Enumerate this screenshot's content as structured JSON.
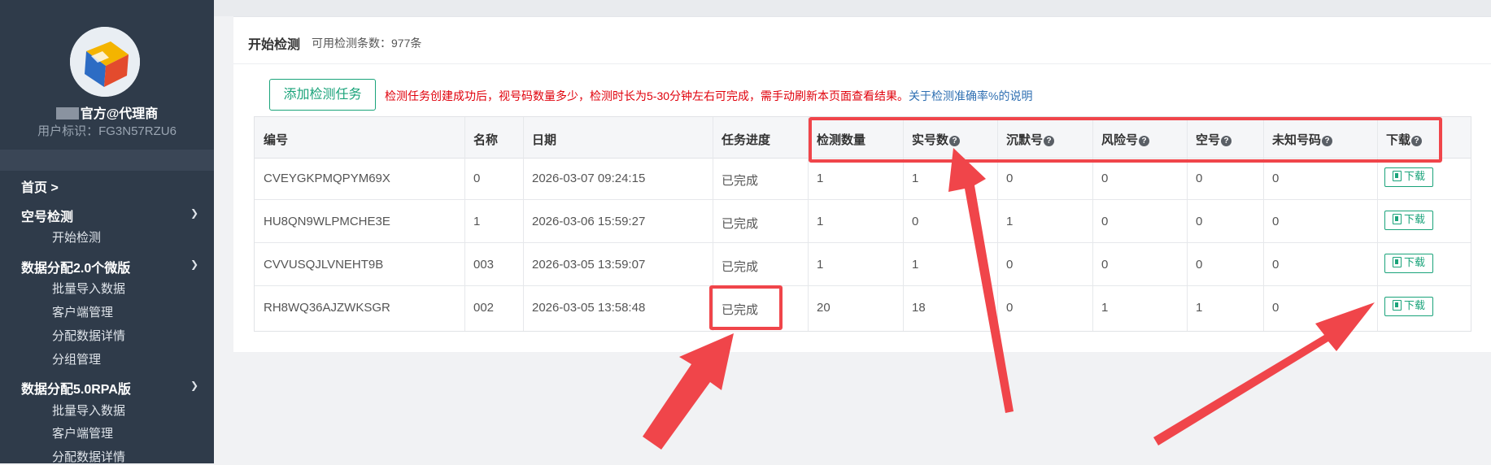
{
  "sidebar": {
    "user_name": "官方@代理商",
    "user_id": "用户标识：FG3N57RZU6",
    "home": "首页 >",
    "groups": [
      {
        "label": "空号检测",
        "items": [
          "开始检测"
        ]
      },
      {
        "label": "数据分配2.0个微版",
        "items": [
          "批量导入数据",
          "客户端管理",
          "分配数据详情",
          "分组管理"
        ]
      },
      {
        "label": "数据分配5.0RPA版",
        "items": [
          "批量导入数据",
          "客户端管理",
          "分配数据详情"
        ]
      }
    ]
  },
  "panel": {
    "title": "开始检测",
    "available": "可用检测条数：977条",
    "add_button": "添加检测任务",
    "notice": "检测任务创建成功后，视号码数量多少，检测时长为5-30分钟左右可完成，需手动刷新本页面查看结果。",
    "notice_link": "关于检测准确率%的说明"
  },
  "table": {
    "columns": [
      "编号",
      "名称",
      "日期",
      "任务进度",
      "检测数量",
      "实号数",
      "沉默号",
      "风险号",
      "空号",
      "未知号码",
      "下载"
    ],
    "help_icon": "?",
    "download_label": "下载",
    "rows": [
      [
        "CVEYGKPMQPYM69X",
        "0",
        "2026-03-07 09:24:15",
        "已完成",
        "1",
        "1",
        "0",
        "0",
        "0",
        "0"
      ],
      [
        "HU8QN9WLPMCHE3E",
        "1",
        "2026-03-06 15:59:27",
        "已完成",
        "1",
        "0",
        "1",
        "0",
        "0",
        "0"
      ],
      [
        "CVVUSQJLVNEHT9B",
        "003",
        "2026-03-05 13:59:07",
        "已完成",
        "1",
        "1",
        "0",
        "0",
        "0",
        "0"
      ],
      [
        "RH8WQ36AJZWKSGR",
        "002",
        "2026-03-05 13:58:48",
        "已完成",
        "20",
        "18",
        "0",
        "1",
        "1",
        "0"
      ]
    ]
  },
  "colors": {
    "accent": "#1aa37a",
    "highlight": "#f0454a",
    "sidebar": "#2f3b4a",
    "notice": "#e0000b"
  }
}
